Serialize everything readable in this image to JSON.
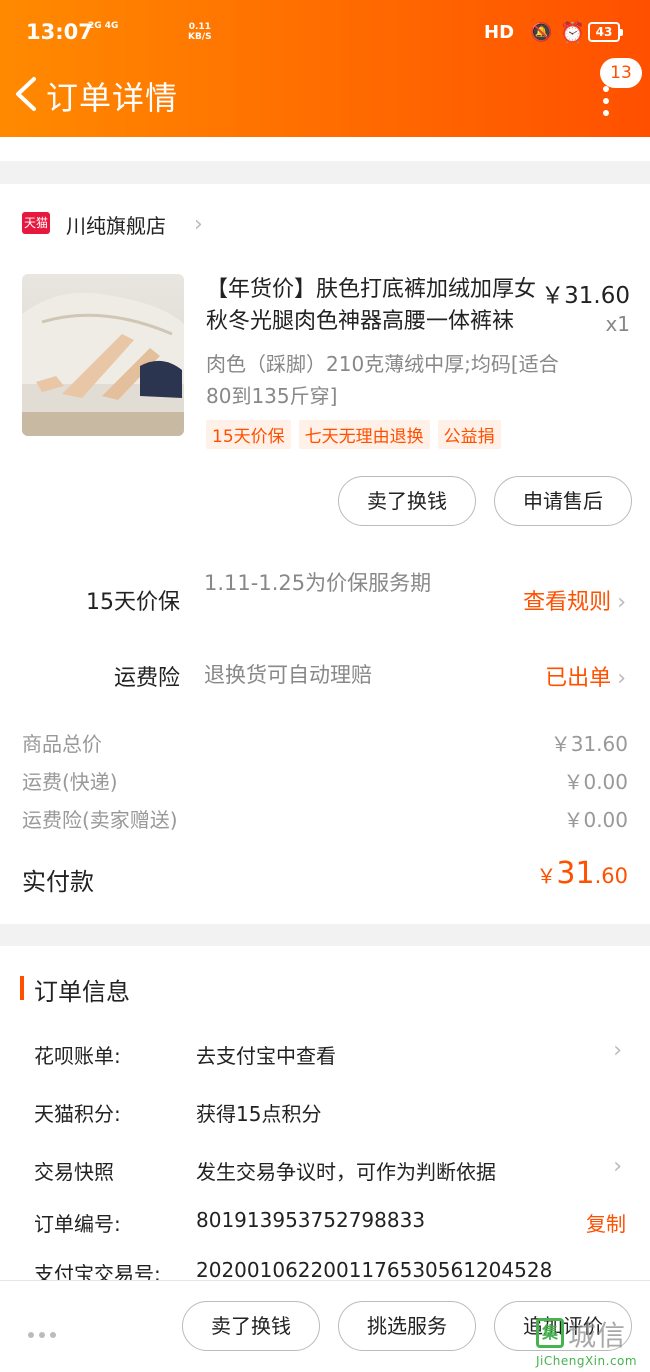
{
  "status_bar": {
    "time": "13:07",
    "network_signal": "2G 4G",
    "speed_value": "0.11",
    "speed_unit": "KB/S",
    "hd_label": "HD",
    "battery": "43"
  },
  "header": {
    "title": "订单详情",
    "message_badge": "13"
  },
  "shop": {
    "logo_text": "天猫",
    "name": "川纯旗舰店"
  },
  "product": {
    "title": "【年货价】肤色打底裤加绒加厚女秋冬光腿肉色神器高腰一体裤袜",
    "price": "￥31.60",
    "quantity": "x1",
    "sku": "肉色（踩脚）210克薄绒中厚;均码[适合80到135斤穿]",
    "tags": [
      "15天价保",
      "七天无理由退换",
      "公益捐"
    ]
  },
  "item_actions": {
    "sell_for_cash": "卖了换钱",
    "after_sales": "申请售后"
  },
  "services": [
    {
      "label": "15天价保",
      "desc": "1.11-1.25为价保服务期",
      "link": "查看规则"
    },
    {
      "label": "运费险",
      "desc": "退换货可自动理赔",
      "link": "已出单"
    }
  ],
  "fees": [
    {
      "label": "商品总价",
      "value": "￥31.60"
    },
    {
      "label": "运费(快递)",
      "value": "￥0.00"
    },
    {
      "label": "运费险(卖家赠送)",
      "value": "￥0.00"
    }
  ],
  "payment": {
    "label": "实付款",
    "currency": "￥",
    "integer": "31",
    "decimal": ".60"
  },
  "order_info": {
    "heading": "订单信息",
    "rows": [
      {
        "label": "花呗账单:",
        "value": "去支付宝中查看"
      },
      {
        "label": "天猫积分:",
        "value": "获得15点积分"
      },
      {
        "label": "交易快照",
        "value": "发生交易争议时，可作为判断依据"
      },
      {
        "label": "订单编号:",
        "value": "801913953752798833"
      },
      {
        "label": "支付宝交易号:",
        "value": "2020010622001176530561204528"
      }
    ],
    "copy_label": "复制"
  },
  "bottom_bar": {
    "sell_for_cash": "卖了换钱",
    "choose_service": "挑选服务",
    "add_review": "追加评价"
  },
  "watermark": {
    "logo_char": "集",
    "text": "城信",
    "url": "JiChengXin.com"
  },
  "colors": {
    "accent": "#ff5000",
    "header_gradient_start": "#ff8a00",
    "header_gradient_end": "#ff5000",
    "tmall_red": "#e6183e",
    "watermark_green": "#47b34f"
  }
}
